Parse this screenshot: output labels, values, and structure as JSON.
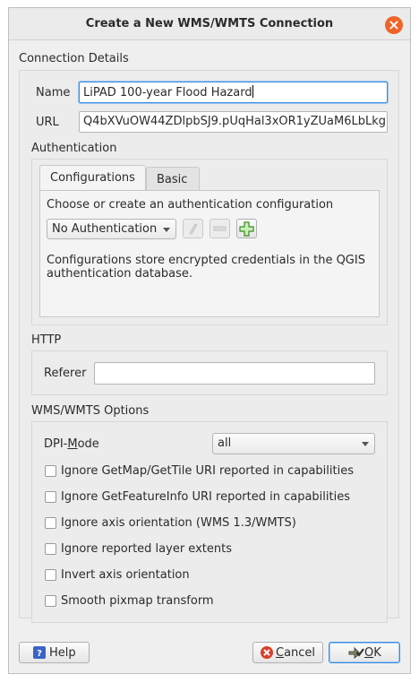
{
  "window": {
    "title": "Create a New WMS/WMTS Connection"
  },
  "connection_details": {
    "title": "Connection Details",
    "name_label": "Name",
    "name_value": "LiPAD 100-year Flood Hazard",
    "url_label": "URL",
    "url_value": "Q4bXVuOW44ZDlpbSJ9.pUqHal3xOR1yZUaM6LbLkg"
  },
  "authentication": {
    "title": "Authentication",
    "tabs": [
      "Configurations",
      "Basic"
    ],
    "active_tab": "Configurations",
    "prompt": "Choose or create an authentication configuration",
    "selected_config": "No Authentication",
    "info_line1": "Configurations store encrypted credentials in the QGIS",
    "info_line2": "authentication database."
  },
  "http": {
    "title": "HTTP",
    "referer_label": "Referer",
    "referer_value": ""
  },
  "wms_options": {
    "title": "WMS/WMTS Options",
    "dpi_label_pre": "DPI-",
    "dpi_label_mnemonic": "M",
    "dpi_label_post": "ode",
    "dpi_value": "all",
    "checkboxes": [
      {
        "label": "Ignore GetMap/GetTile URI reported in capabilities",
        "checked": false
      },
      {
        "label": "Ignore GetFeatureInfo URI reported in capabilities",
        "checked": false
      },
      {
        "label": "Ignore axis orientation (WMS 1.3/WMTS)",
        "checked": false
      },
      {
        "label": "Ignore reported layer extents",
        "checked": false
      },
      {
        "label": "Invert axis orientation",
        "checked": false
      },
      {
        "label": "Smooth pixmap transform",
        "checked": false
      }
    ]
  },
  "buttons": {
    "help": "Help",
    "cancel_mnemonic": "C",
    "cancel_rest": "ancel",
    "ok_mnemonic": "O",
    "ok_rest": "K"
  },
  "colors": {
    "accent": "#3d8ddc",
    "close": "#f0642a"
  }
}
